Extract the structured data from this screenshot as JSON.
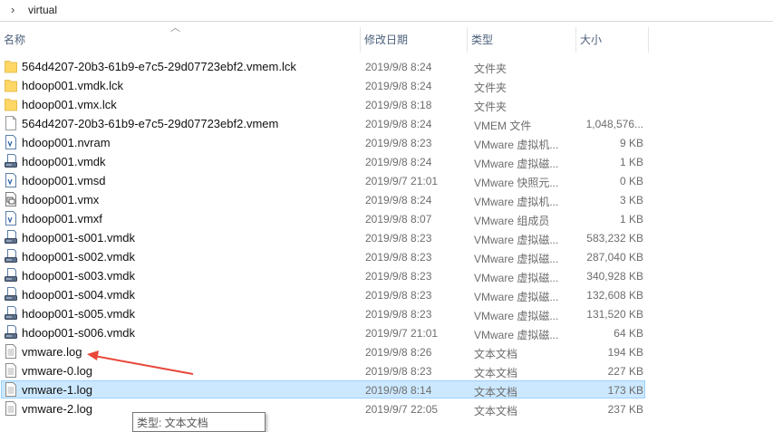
{
  "address": {
    "path": "virtual"
  },
  "columns": {
    "name": "名称",
    "date": "修改日期",
    "type": "类型",
    "size": "大小"
  },
  "files": [
    {
      "name": "564d4207-20b3-61b9-e7c5-29d07723ebf2.vmem.lck",
      "date": "2019/9/8 8:24",
      "type": "文件夹",
      "size": "",
      "icon": "folder-icon"
    },
    {
      "name": "hdoop001.vmdk.lck",
      "date": "2019/9/8 8:24",
      "type": "文件夹",
      "size": "",
      "icon": "folder-icon"
    },
    {
      "name": "hdoop001.vmx.lck",
      "date": "2019/9/8 8:18",
      "type": "文件夹",
      "size": "",
      "icon": "folder-icon"
    },
    {
      "name": "564d4207-20b3-61b9-e7c5-29d07723ebf2.vmem",
      "date": "2019/9/8 8:24",
      "type": "VMEM 文件",
      "size": "1,048,576...",
      "icon": "blank-file-icon"
    },
    {
      "name": "hdoop001.nvram",
      "date": "2019/9/8 8:23",
      "type": "VMware 虚拟机...",
      "size": "9 KB",
      "icon": "vmware-doc-icon"
    },
    {
      "name": "hdoop001.vmdk",
      "date": "2019/9/8 8:24",
      "type": "VMware 虚拟磁...",
      "size": "1 KB",
      "icon": "disk-icon"
    },
    {
      "name": "hdoop001.vmsd",
      "date": "2019/9/7 21:01",
      "type": "VMware 快照元...",
      "size": "0 KB",
      "icon": "vmware-doc-icon"
    },
    {
      "name": "hdoop001.vmx",
      "date": "2019/9/8 8:24",
      "type": "VMware 虚拟机...",
      "size": "3 KB",
      "icon": "vm-config-icon"
    },
    {
      "name": "hdoop001.vmxf",
      "date": "2019/9/8 8:07",
      "type": "VMware 组成员",
      "size": "1 KB",
      "icon": "vmware-doc-icon"
    },
    {
      "name": "hdoop001-s001.vmdk",
      "date": "2019/9/8 8:23",
      "type": "VMware 虚拟磁...",
      "size": "583,232 KB",
      "icon": "disk-icon"
    },
    {
      "name": "hdoop001-s002.vmdk",
      "date": "2019/9/8 8:23",
      "type": "VMware 虚拟磁...",
      "size": "287,040 KB",
      "icon": "disk-icon"
    },
    {
      "name": "hdoop001-s003.vmdk",
      "date": "2019/9/8 8:23",
      "type": "VMware 虚拟磁...",
      "size": "340,928 KB",
      "icon": "disk-icon"
    },
    {
      "name": "hdoop001-s004.vmdk",
      "date": "2019/9/8 8:23",
      "type": "VMware 虚拟磁...",
      "size": "132,608 KB",
      "icon": "disk-icon"
    },
    {
      "name": "hdoop001-s005.vmdk",
      "date": "2019/9/8 8:23",
      "type": "VMware 虚拟磁...",
      "size": "131,520 KB",
      "icon": "disk-icon"
    },
    {
      "name": "hdoop001-s006.vmdk",
      "date": "2019/9/7 21:01",
      "type": "VMware 虚拟磁...",
      "size": "64 KB",
      "icon": "disk-icon"
    },
    {
      "name": "vmware.log",
      "date": "2019/9/8 8:26",
      "type": "文本文档",
      "size": "194 KB",
      "icon": "text-file-icon"
    },
    {
      "name": "vmware-0.log",
      "date": "2019/9/8 8:23",
      "type": "文本文档",
      "size": "227 KB",
      "icon": "text-file-icon"
    },
    {
      "name": "vmware-1.log",
      "date": "2019/9/8 8:14",
      "type": "文本文档",
      "size": "173 KB",
      "icon": "text-file-icon",
      "selected": true
    },
    {
      "name": "vmware-2.log",
      "date": "2019/9/7 22:05",
      "type": "文本文档",
      "size": "237 KB",
      "icon": "text-file-icon"
    }
  ],
  "tooltip": {
    "text": "类型: 文本文档"
  },
  "colors": {
    "selection": "#cce8ff",
    "selection_border": "#99d1ff",
    "arrow": "#e8473a",
    "folder": "#ffd766"
  }
}
